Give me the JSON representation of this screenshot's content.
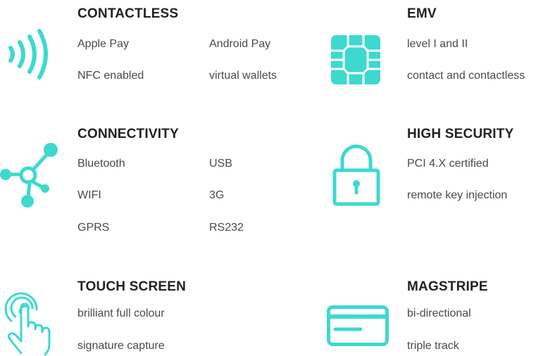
{
  "theme": {
    "accent": "#3dd9cf",
    "title_color": "#222222",
    "text_color": "#4a4a4a"
  },
  "features": [
    {
      "icon": "contactless-wave-icon",
      "title": "CONTACTLESS",
      "items": [
        "Apple Pay",
        "Android Pay",
        "NFC enabled",
        "virtual wallets"
      ]
    },
    {
      "icon": "emv-chip-icon",
      "title": "EMV",
      "items": [
        "level I and II",
        "contact and contactless"
      ]
    },
    {
      "icon": "network-nodes-icon",
      "title": "CONNECTIVITY",
      "items": [
        "Bluetooth",
        "USB",
        "WIFI",
        "3G",
        "GPRS",
        "RS232"
      ]
    },
    {
      "icon": "padlock-icon",
      "title": "HIGH SECURITY",
      "items": [
        "PCI 4.X certified",
        "remote key injection"
      ]
    },
    {
      "icon": "touch-hand-icon",
      "title": "TOUCH SCREEN",
      "items": [
        "brilliant full colour",
        "signature capture"
      ]
    },
    {
      "icon": "card-icon",
      "title": "MAGSTRIPE",
      "items": [
        "bi-directional",
        "triple track"
      ]
    }
  ]
}
